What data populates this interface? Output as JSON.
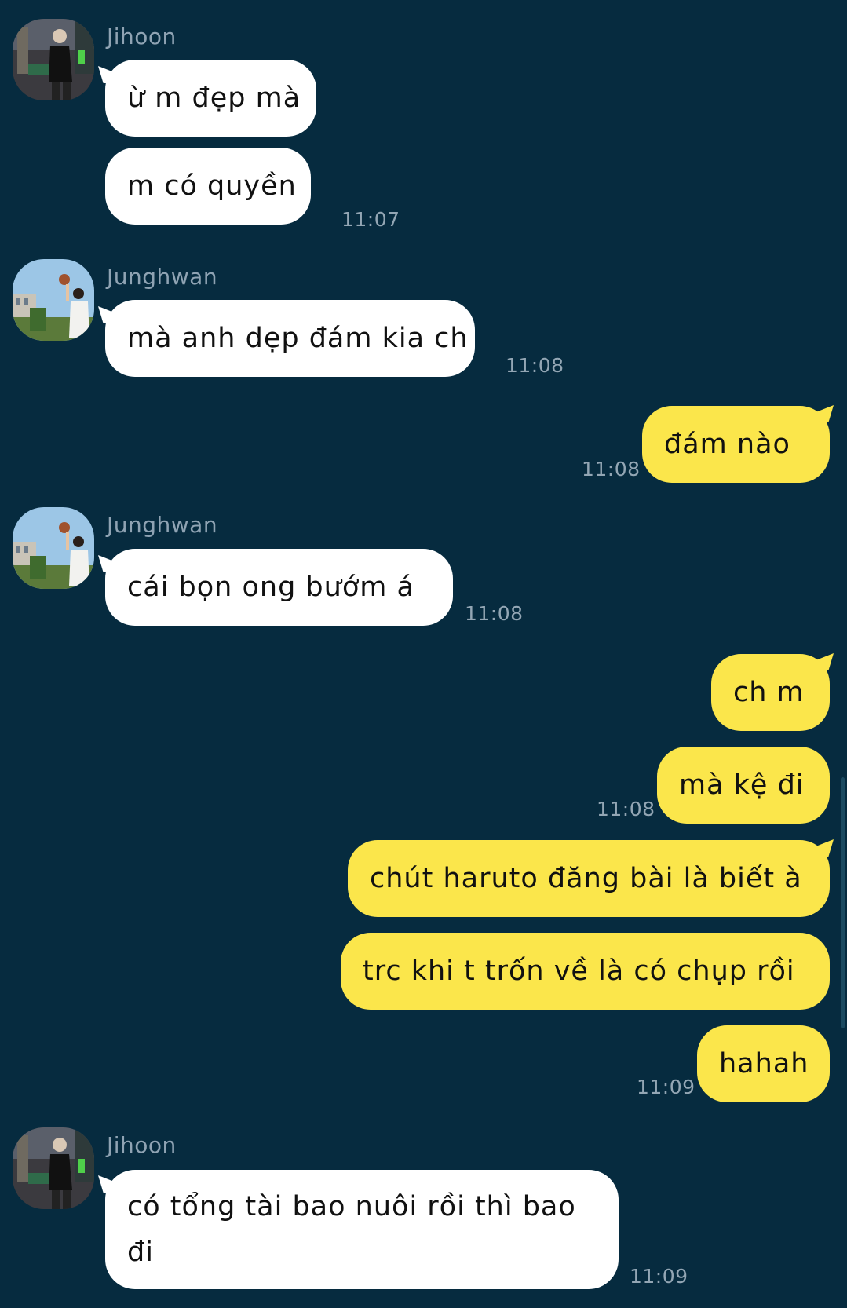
{
  "messages": {
    "m1": {
      "sender": "Jihoon",
      "text": "ừ m đẹp mà"
    },
    "m2": {
      "text": "m có quyền",
      "time": "11:07"
    },
    "m3": {
      "sender": "Junghwan",
      "text": "mà anh dẹp đám kia ch",
      "time": "11:08"
    },
    "m4": {
      "text": "đám nào",
      "time": "11:08"
    },
    "m5": {
      "sender": "Junghwan",
      "text": "cái bọn ong bướm á",
      "time": "11:08"
    },
    "m6": {
      "text": "ch m"
    },
    "m7": {
      "text": "mà kệ đi",
      "time": "11:08"
    },
    "m8": {
      "text": "chút haruto đăng bài là biết à"
    },
    "m9": {
      "text": "trc khi t trốn về là có chụp rồi"
    },
    "m10": {
      "text": "hahah",
      "time": "11:09"
    },
    "m11": {
      "sender": "Jihoon",
      "text": "có tổng tài bao nuôi rồi thì bao đi",
      "time": "11:09"
    }
  },
  "colors": {
    "background": "#062b3f",
    "incoming_bubble": "#ffffff",
    "outgoing_bubble": "#fbe64b",
    "timestamp": "#93a6b4"
  }
}
